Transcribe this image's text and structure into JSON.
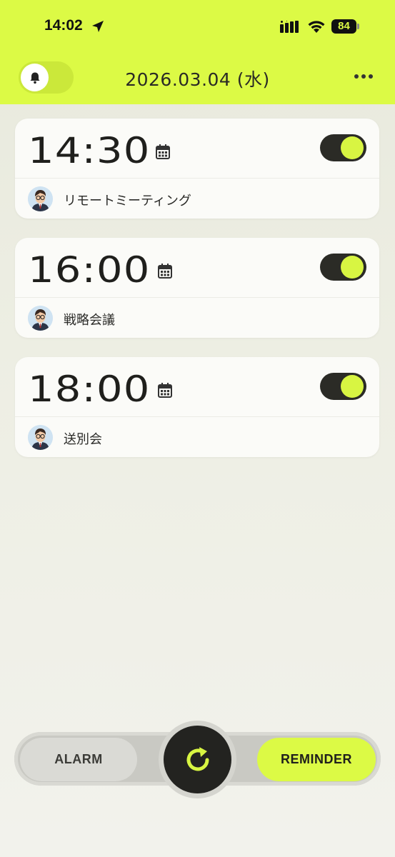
{
  "status_bar": {
    "time": "14:02",
    "battery": "84"
  },
  "header": {
    "date": "2026.03.04 (水)",
    "accent_color": "#dcfa45"
  },
  "reminders": [
    {
      "time": "14:30",
      "label": "リモートミーティング",
      "enabled": true
    },
    {
      "time": "16:00",
      "label": "戦略会議",
      "enabled": true
    },
    {
      "time": "18:00",
      "label": "送別会",
      "enabled": true
    }
  ],
  "bottom_nav": {
    "alarm_label": "ALARM",
    "reminder_label": "REMINDER",
    "active": "REMINDER"
  },
  "icons": {
    "bell": "bell-icon",
    "more": "more-icon",
    "calendar": "calendar-icon",
    "refresh": "refresh-icon",
    "location": "location-arrow-icon",
    "signal": "signal-icon",
    "wifi": "wifi-icon"
  }
}
